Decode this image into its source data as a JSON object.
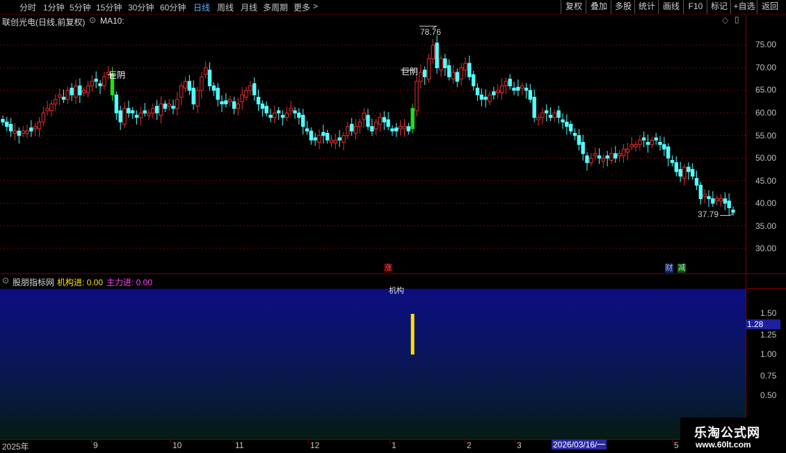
{
  "toolbar": {
    "periods": [
      {
        "label": "分时"
      },
      {
        "label": "1分钟"
      },
      {
        "label": "5分钟"
      },
      {
        "label": "15分钟"
      },
      {
        "label": "30分钟"
      },
      {
        "label": "60分钟"
      },
      {
        "label": "日线",
        "active": true
      },
      {
        "label": "周线"
      },
      {
        "label": "月线"
      },
      {
        "label": "多周期"
      },
      {
        "label": "更多"
      }
    ],
    "more_arrow": ">",
    "actions": [
      {
        "label": "复权"
      },
      {
        "label": "叠加"
      },
      {
        "label": "多股"
      },
      {
        "label": "统计"
      },
      {
        "label": "画线"
      },
      {
        "label": "F10"
      },
      {
        "label": "标记"
      },
      {
        "label": "+自选"
      },
      {
        "label": "返回"
      }
    ]
  },
  "main": {
    "title": "联创光电(日线,前复权)",
    "indicator": "MA10:",
    "price_labels": [
      "75.00",
      "70.00",
      "65.00",
      "60.00",
      "55.00",
      "50.00",
      "45.00",
      "40.00",
      "35.00",
      "30.00"
    ],
    "high_label": "78.76",
    "low_label": "37.79",
    "marker_label_1": "巨阴",
    "marker_label_2": "巨阴",
    "badge_zhang": "涨",
    "badge_cai": "财",
    "badge_jian": "减"
  },
  "sub": {
    "title": "股朋指标网",
    "inst_label": "机构进: 0.00",
    "main_label": "主力进: 0.00",
    "bar_text": "机构",
    "value_labels": [
      "1.50",
      "1.25",
      "1.00",
      "0.75",
      "0.50"
    ],
    "cursor_value": "1.28"
  },
  "axis": {
    "dates": [
      {
        "label": "2025年"
      },
      {
        "label": "9"
      },
      {
        "label": "10"
      },
      {
        "label": "11"
      },
      {
        "label": "12"
      },
      {
        "label": "1"
      },
      {
        "label": "2"
      },
      {
        "label": "3"
      },
      {
        "label": "5"
      }
    ],
    "cursor_date": "2026/03/16/一"
  },
  "watermark": {
    "title": "乐淘公式网",
    "url": "www.60lt.com"
  },
  "colors": {
    "up": "#e83030",
    "down": "#54ffff",
    "highlight": "#20e020",
    "bar": "#ffe000",
    "grid": "#7a0000"
  },
  "chart_data": {
    "type": "candlestick",
    "series": [
      {
        "name": "联创光电",
        "close": [
          58,
          57,
          56,
          56,
          55,
          56,
          56,
          56,
          57,
          58,
          60,
          61,
          62,
          63,
          64,
          63,
          65,
          64,
          66,
          64,
          65,
          66,
          67,
          67,
          66,
          68,
          69,
          64,
          60,
          58,
          61,
          60,
          60,
          59,
          60,
          60,
          60,
          61,
          60,
          62,
          61,
          62,
          61,
          63,
          66,
          67,
          65,
          62,
          65,
          68,
          70,
          66,
          65,
          63,
          62,
          62,
          63,
          61,
          62,
          64,
          65,
          66,
          64,
          62,
          61,
          60,
          59,
          60,
          60,
          59,
          60,
          61,
          60,
          59,
          57,
          56,
          54,
          54,
          55,
          55,
          54,
          54,
          54,
          54,
          55,
          57,
          56,
          57,
          58,
          60,
          57,
          56,
          58,
          59,
          58,
          57,
          56,
          56,
          57,
          57,
          56,
          61,
          67,
          69,
          68,
          72,
          75,
          70,
          72,
          70,
          68,
          69,
          67,
          70,
          71,
          68,
          66,
          64,
          63,
          63,
          64,
          64,
          65,
          66,
          67,
          66,
          65,
          65,
          66,
          65,
          63,
          59,
          59,
          60,
          60,
          59,
          60,
          59,
          58,
          57,
          56,
          55,
          53,
          51,
          49,
          50,
          51,
          50,
          50,
          50,
          51,
          50,
          51,
          52,
          52,
          53,
          53,
          54,
          54,
          53,
          54,
          54,
          53,
          52,
          50,
          49,
          47,
          46,
          48,
          47,
          46,
          44,
          41,
          42,
          41,
          40,
          41,
          41,
          40,
          39,
          38
        ]
      }
    ],
    "ylim": [
      30,
      79
    ],
    "high": 78.76,
    "low": 37.79,
    "x_ticks": [
      "2025年",
      "9",
      "10",
      "11",
      "12",
      "1",
      "2",
      "3",
      "5"
    ]
  }
}
